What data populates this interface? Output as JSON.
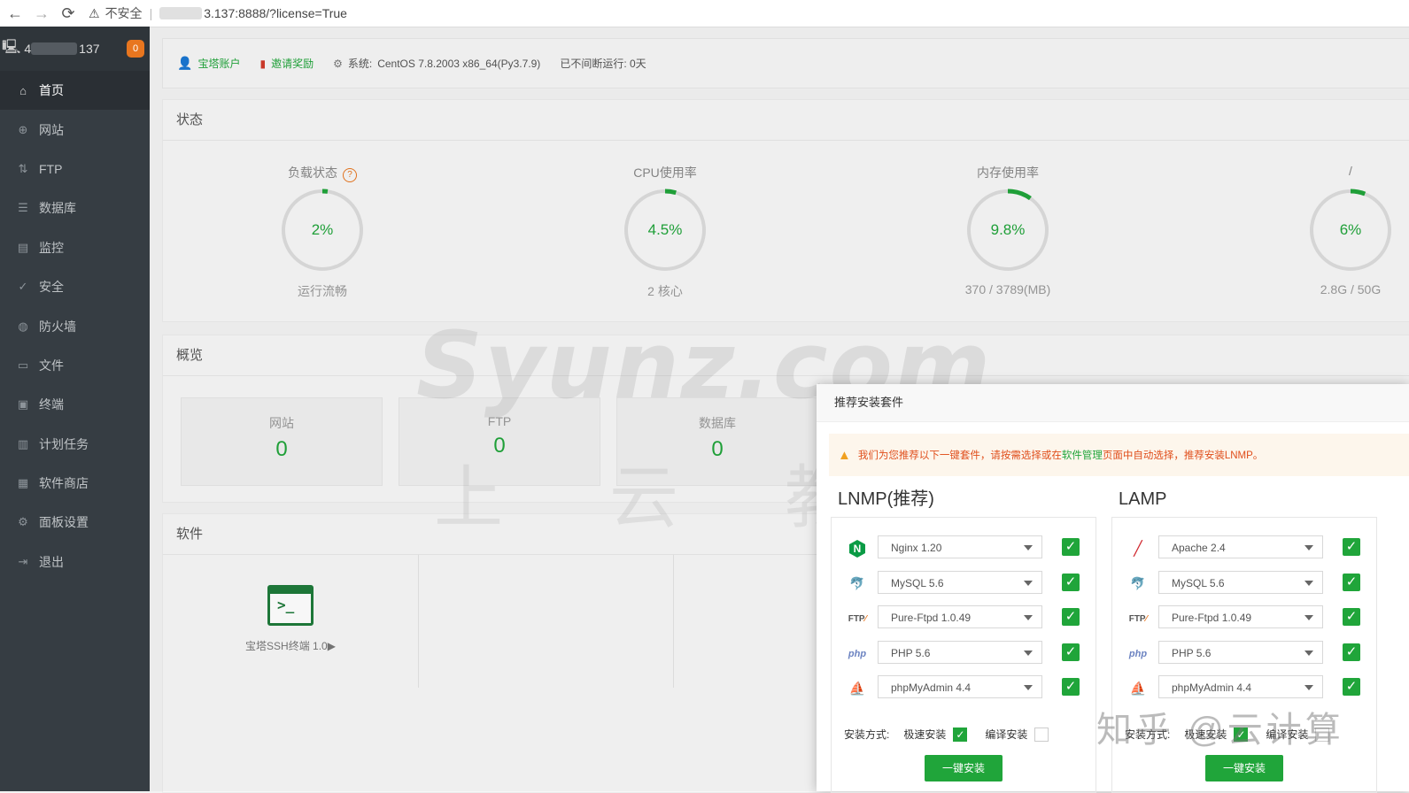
{
  "browser": {
    "back": "←",
    "forward": "→",
    "reload": "⟳",
    "warn": "⚠",
    "insecure": "不安全",
    "separator": "|",
    "url_suffix": "3.137:8888/?license=True"
  },
  "sidebar": {
    "server_prefix": "4",
    "server_suffix": "137",
    "badge": "0",
    "items": [
      {
        "label": "首页",
        "icon": "⌂"
      },
      {
        "label": "网站",
        "icon": "⊕"
      },
      {
        "label": "FTP",
        "icon": "⇅"
      },
      {
        "label": "数据库",
        "icon": "☰"
      },
      {
        "label": "监控",
        "icon": "▤"
      },
      {
        "label": "安全",
        "icon": "✓"
      },
      {
        "label": "防火墙",
        "icon": "◍"
      },
      {
        "label": "文件",
        "icon": "▭"
      },
      {
        "label": "终端",
        "icon": "▣"
      },
      {
        "label": "计划任务",
        "icon": "▥"
      },
      {
        "label": "软件商店",
        "icon": "▦"
      },
      {
        "label": "面板设置",
        "icon": "⚙"
      },
      {
        "label": "退出",
        "icon": "⇥"
      }
    ]
  },
  "topbar": {
    "account": "宝塔账户",
    "invite": "邀请奖励",
    "system_label": "系统:",
    "system_value": "CentOS 7.8.2003 x86_64(Py3.7.9)",
    "uptime": "已不间断运行: 0天"
  },
  "status": {
    "title": "状态",
    "gauges": [
      {
        "title": "负载状态",
        "value": "2%",
        "sub": "运行流畅",
        "percent": 2,
        "help": "?"
      },
      {
        "title": "CPU使用率",
        "value": "4.5%",
        "sub": "2 核心",
        "percent": 4.5
      },
      {
        "title": "内存使用率",
        "value": "9.8%",
        "sub": "370 / 3789(MB)",
        "percent": 9.8
      },
      {
        "title": "/",
        "value": "6%",
        "sub": "2.8G / 50G",
        "percent": 6
      }
    ]
  },
  "overview": {
    "title": "概览",
    "cards": [
      {
        "label": "网站",
        "value": "0"
      },
      {
        "label": "FTP",
        "value": "0"
      },
      {
        "label": "数据库",
        "value": "0"
      }
    ]
  },
  "software": {
    "title": "软件",
    "items": [
      {
        "name": "宝塔SSH终端 1.0▶"
      }
    ]
  },
  "watermark": {
    "main": "Syunz.com",
    "sub": "上云教程",
    "zhihu": "知乎 @云计算"
  },
  "modal": {
    "title": "推荐安装套件",
    "notice_pre": "我们为您推荐以下一键套件，请按需选择或在",
    "notice_link": "软件管理",
    "notice_post": "页面中自动选择，推荐安装LNMP。",
    "lnmp": {
      "title": "LNMP(推荐)",
      "rows": [
        "Nginx 1.20",
        "MySQL 5.6",
        "Pure-Ftpd 1.0.49",
        "PHP 5.6",
        "phpMyAdmin 4.4"
      ],
      "mode_label": "安装方式:",
      "fast": "极速安装",
      "compile": "编译安装",
      "button": "一键安装"
    },
    "lamp": {
      "title": "LAMP",
      "rows": [
        "Apache 2.4",
        "MySQL 5.6",
        "Pure-Ftpd 1.0.49",
        "PHP 5.6",
        "phpMyAdmin 4.4"
      ],
      "mode_label": "安装方式:",
      "fast": "极速安装",
      "compile": "编译安装",
      "button": "一键安装"
    },
    "logos": {
      "nginx": "N",
      "ftp": "FTP",
      "ftp_mark": "⁄",
      "php": "php",
      "mysql": "🐬",
      "pma": "⛵",
      "apache": "╱",
      "check": "✓"
    },
    "accent": "#20a53a"
  }
}
